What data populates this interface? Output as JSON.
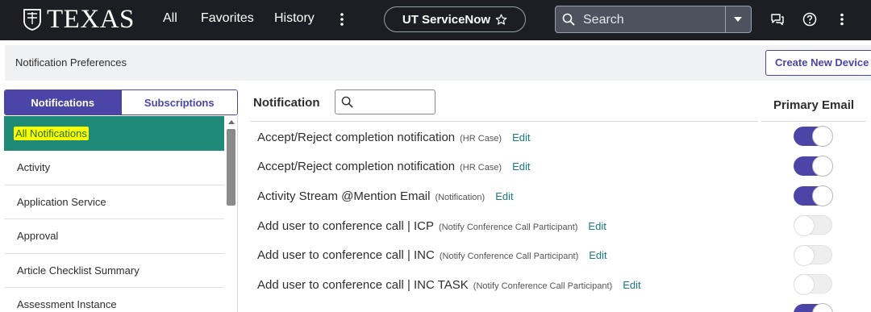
{
  "topnav": {
    "logo_text": "TEXAS",
    "links": [
      "All",
      "Favorites",
      "History"
    ],
    "app_pill": "UT ServiceNow",
    "search_placeholder": "Search",
    "icons": [
      "more-vertical-icon",
      "star-icon",
      "search-icon",
      "chevron-down-icon",
      "chat-icon",
      "help-icon",
      "more-vertical-icon"
    ]
  },
  "header": {
    "title": "Notification Preferences",
    "create_button": "Create New Device"
  },
  "tabs": {
    "notifications": "Notifications",
    "subscriptions": "Subscriptions"
  },
  "categories": [
    "All Notifications",
    "Activity",
    "Application Service",
    "Approval",
    "Article Checklist Summary",
    "Assessment Instance"
  ],
  "table": {
    "column_notification": "Notification",
    "column_primary_email": "Primary Email",
    "edit_label": "Edit",
    "rows": [
      {
        "name": "Accept/Reject completion notification",
        "context": "(HR Case)",
        "enabled": true
      },
      {
        "name": "Accept/Reject completion notification",
        "context": "(HR Case)",
        "enabled": true
      },
      {
        "name": "Activity Stream @Mention Email",
        "context": "(Notification)",
        "enabled": true
      },
      {
        "name": "Add user to conference call | ICP",
        "context": "(Notify Conference Call Participant)",
        "enabled": false
      },
      {
        "name": "Add user to conference call | INC",
        "context": "(Notify Conference Call Participant)",
        "enabled": false
      },
      {
        "name": "Add user to conference call | INC TASK",
        "context": "(Notify Conference Call Participant)",
        "enabled": false
      }
    ]
  },
  "colors": {
    "nav_bg": "#1c1e24",
    "accent": "#4b45a7",
    "selected_bg": "#1f8a78",
    "highlight": "#f7ff00",
    "link": "#1a7a86"
  }
}
